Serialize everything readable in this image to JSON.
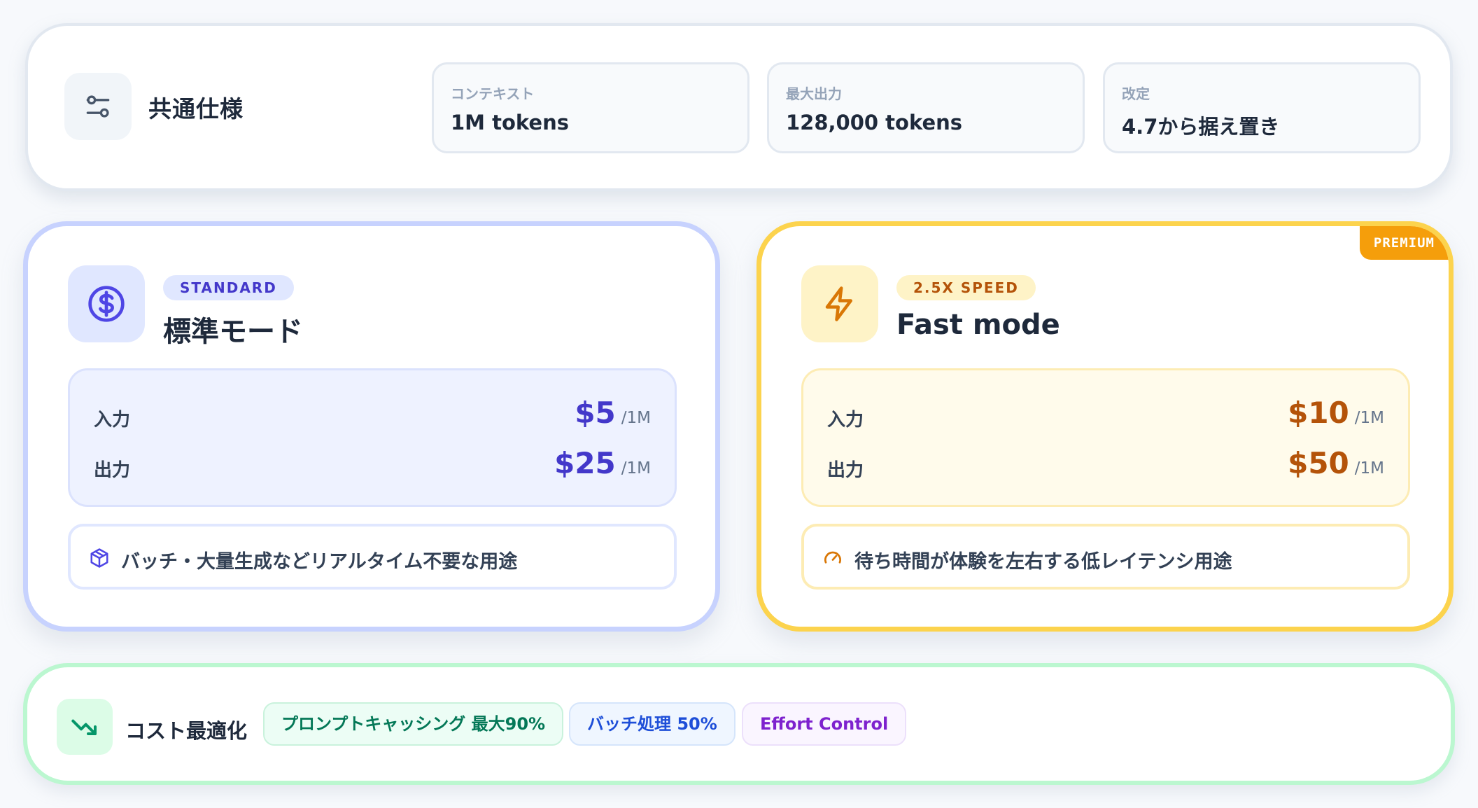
{
  "spec": {
    "title": "共通仕様",
    "icon": "sliders-icon",
    "items": [
      {
        "label": "コンテキスト",
        "value": "1M tokens"
      },
      {
        "label": "最大出力",
        "value": "128,000 tokens"
      },
      {
        "label": "改定",
        "value": "4.7から据え置き"
      }
    ]
  },
  "standard": {
    "badge": "STANDARD",
    "name": "標準モード",
    "icon": "dollar-circle-icon",
    "prices": [
      {
        "label": "入力",
        "amount": "$5",
        "unit": "/1M"
      },
      {
        "label": "出力",
        "amount": "$25",
        "unit": "/1M"
      }
    ],
    "usecase_icon": "package-icon",
    "usecase": "バッチ・大量生成などリアルタイム不要な用途",
    "accent": "#4338ca"
  },
  "fast": {
    "tag": "PREMIUM",
    "badge": "2.5X SPEED",
    "name": "Fast mode",
    "icon": "lightning-icon",
    "prices": [
      {
        "label": "入力",
        "amount": "$10",
        "unit": "/1M"
      },
      {
        "label": "出力",
        "amount": "$50",
        "unit": "/1M"
      }
    ],
    "usecase_icon": "gauge-icon",
    "usecase": "待ち時間が体験を左右する低レイテンシ用途",
    "accent": "#b45309"
  },
  "optimization": {
    "title": "コスト最適化",
    "icon": "trending-down-icon",
    "chips": [
      "プロンプトキャッシング 最大90%",
      "バッチ処理 50%",
      "Effort Control"
    ]
  }
}
